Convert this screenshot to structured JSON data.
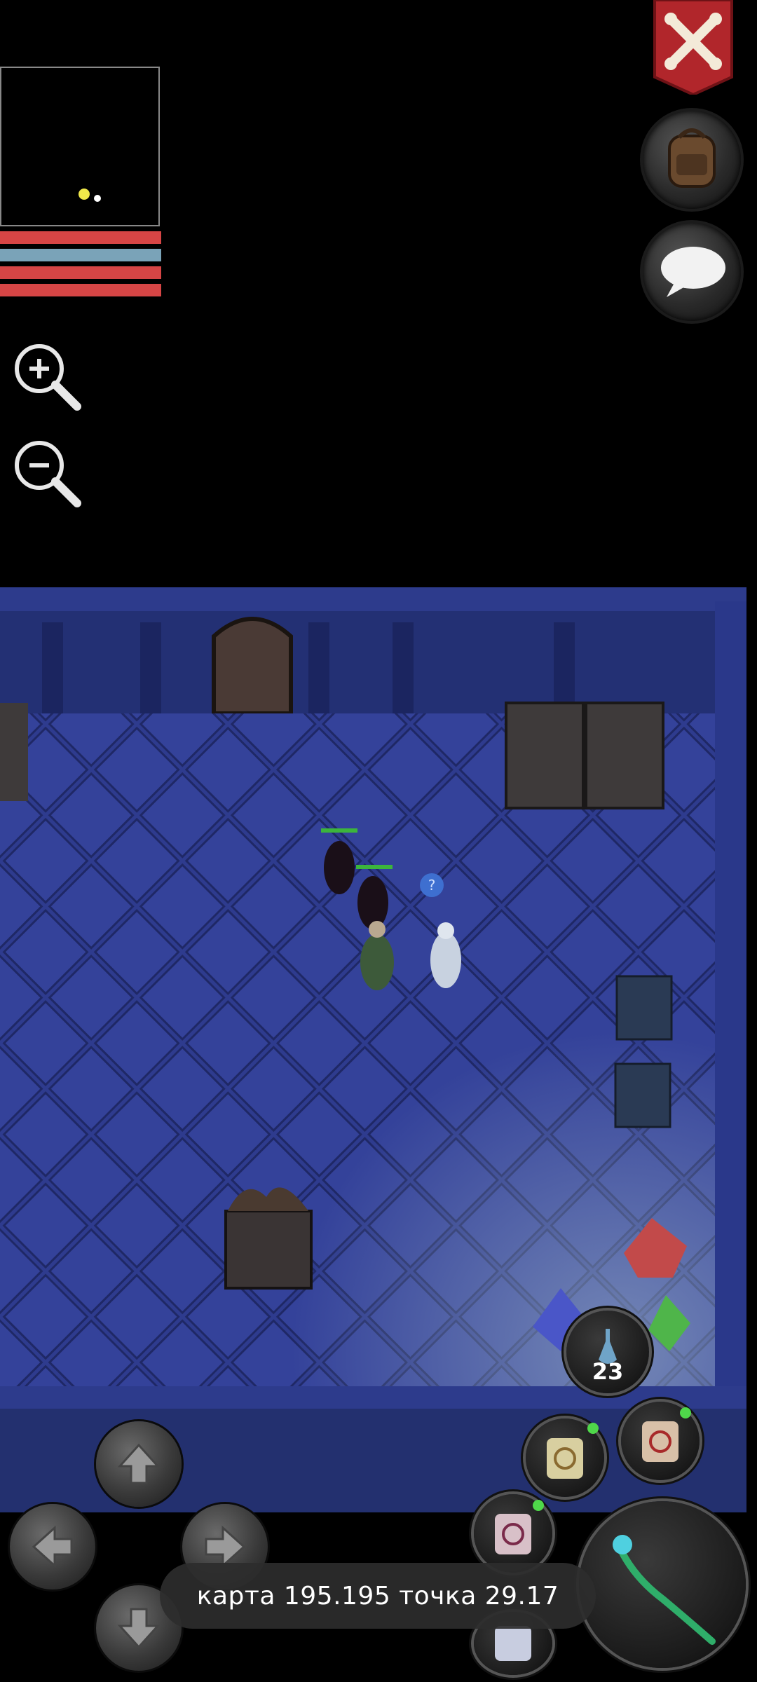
{
  "toast": {
    "text": "карта 195.195 точка 29.17"
  },
  "quickslot": {
    "count": "23"
  },
  "stat_bars": [
    {
      "name": "health",
      "color": "#d64545",
      "fill": 1.0
    },
    {
      "name": "mana",
      "color": "#7aa3b8",
      "fill": 1.0
    },
    {
      "name": "stamina",
      "color": "#d64545",
      "fill": 1.0
    },
    {
      "name": "experience",
      "color": "#d64545",
      "fill": 1.0
    }
  ],
  "icons": {
    "zoom_in": "zoom-in-icon",
    "zoom_out": "zoom-out-icon",
    "close_banner": "crossed-bones-icon",
    "inventory": "backpack-icon",
    "chat": "speech-bubble-icon",
    "quest": "question-mark-icon"
  },
  "colors": {
    "banner": "#b1262b",
    "world_floor": "#2c3a8e",
    "toast_bg": "#2d2d2d"
  }
}
